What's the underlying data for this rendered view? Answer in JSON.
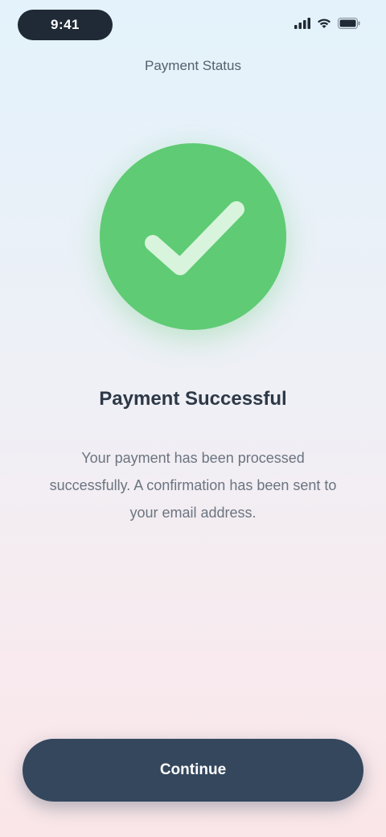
{
  "status_bar": {
    "time": "9:41",
    "icons": [
      "signal-icon",
      "wifi-icon",
      "battery-icon"
    ]
  },
  "header": {
    "title": "Payment Status"
  },
  "result": {
    "icon": "checkmark-icon",
    "title": "Payment Successful",
    "message": "Your payment has been processed successfully. A confirmation has been sent to your email address."
  },
  "actions": {
    "primary_label": "Continue"
  },
  "colors": {
    "success": "#5fcb74",
    "button": "#34475d",
    "title_text": "#2e3947",
    "body_text": "#6b7480"
  }
}
